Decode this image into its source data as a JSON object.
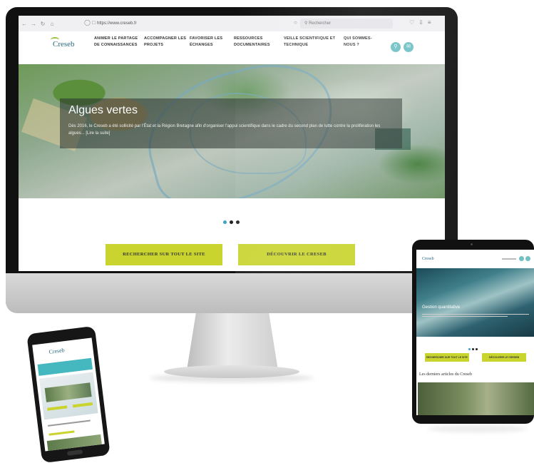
{
  "browser": {
    "url": "https://www.creseb.fr",
    "search_placeholder": "Rechercher"
  },
  "site": {
    "logo_text": "Creseb",
    "nav": [
      {
        "label": "ANIMER LE PARTAGE DE CONNAISSANCES"
      },
      {
        "label": "ACCOMPAGNER LES PROJETS"
      },
      {
        "label": "FAVORISER LES ÉCHANGES"
      },
      {
        "label": "RESSOURCES DOCUMENTAIRES"
      },
      {
        "label": "VEILLE SCIENTIFIQUE ET TECHNIQUE"
      },
      {
        "label": "QUI SOMMES-NOUS ?"
      }
    ],
    "hero": {
      "title": "Algues vertes",
      "text": "Dès 2016, le Creseb a été sollicité par l'État et la Région Bretagne afin d'organiser l'appui scientifique dans le cadre du second plan de lutte contre la prolifération les algues... [Lire la suite]"
    },
    "carousel_dots": 3,
    "carousel_active_index": 0,
    "cta": {
      "search_all": "RECHERCHER SUR TOUT LE SITE",
      "discover": "DÉCOUVRIR LE CRESEB"
    }
  },
  "tablet": {
    "logo_text": "Creseb",
    "hero_title": "Gestion quantitative",
    "cta": {
      "search_all": "RECHERCHER SUR TOUT LE SITE",
      "discover": "DÉCOUVRIR LE CRESEB"
    },
    "section_title": "Les derniers articles du Creseb"
  },
  "phone": {
    "logo_text": "Creseb"
  },
  "colors": {
    "accent_green": "#c9d42e",
    "accent_teal": "#45b7bf",
    "logo_blue": "#2a6a80"
  }
}
